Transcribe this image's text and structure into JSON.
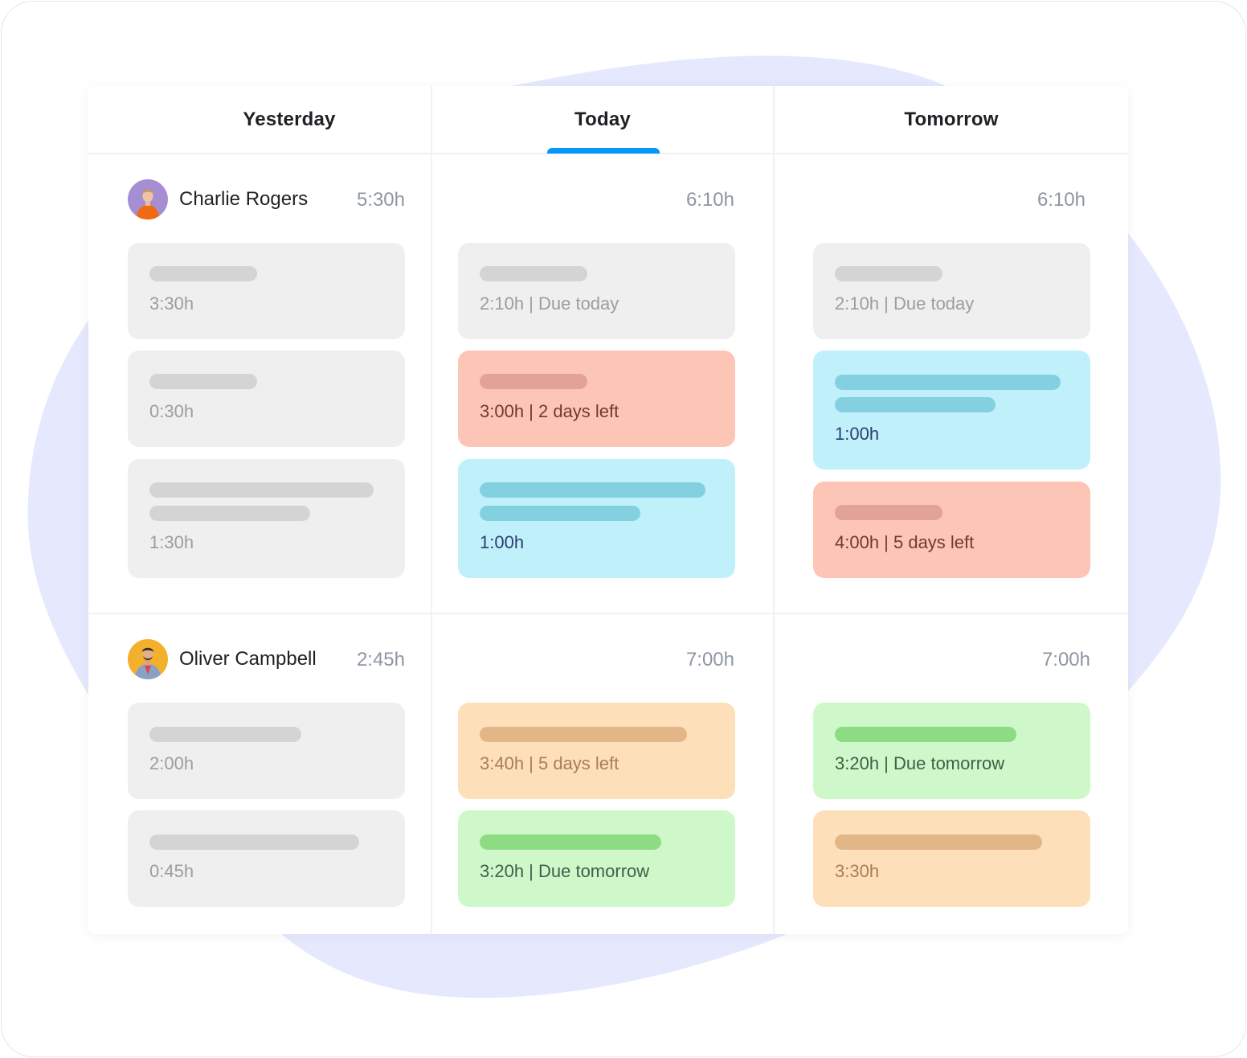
{
  "tabs": [
    {
      "label": "Yesterday",
      "active": false
    },
    {
      "label": "Today",
      "active": true
    },
    {
      "label": "Tomorrow",
      "active": false
    }
  ],
  "colors": {
    "accent": "#0596f7",
    "blob": "#e6e9fd",
    "grey_card": "#efefef",
    "red_card": "#fdc5b6",
    "blue_card": "#c0f1fb",
    "orange_card": "#fddfb9",
    "green_card": "#cef8c9"
  },
  "people": [
    {
      "name": "Charlie Rogers",
      "avatar": "avatar-purple-orange-sweater",
      "totals": [
        "5:30h",
        "6:10h",
        "6:10h"
      ],
      "days": [
        [
          {
            "color": "grey",
            "label": "3:30h"
          },
          {
            "color": "grey",
            "label": "0:30h"
          },
          {
            "color": "grey",
            "label": "1:30h"
          }
        ],
        [
          {
            "color": "grey",
            "label": "2:10h | Due today"
          },
          {
            "color": "red",
            "label": "3:00h | 2 days left"
          },
          {
            "color": "blue",
            "label": "1:00h"
          }
        ],
        [
          {
            "color": "grey",
            "label": "2:10h | Due today"
          },
          {
            "color": "blue",
            "label": "1:00h"
          },
          {
            "color": "red",
            "label": "4:00h | 5 days left"
          }
        ]
      ]
    },
    {
      "name": "Oliver Campbell",
      "avatar": "avatar-yellow-denim-jacket",
      "totals": [
        "2:45h",
        "7:00h",
        "7:00h"
      ],
      "days": [
        [
          {
            "color": "grey",
            "label": "2:00h"
          },
          {
            "color": "grey",
            "label": "0:45h"
          }
        ],
        [
          {
            "color": "orange",
            "label": "3:40h | 5 days left"
          },
          {
            "color": "green",
            "label": "3:20h | Due tomorrow"
          }
        ],
        [
          {
            "color": "green",
            "label": "3:20h | Due tomorrow"
          },
          {
            "color": "orange",
            "label": "3:30h"
          }
        ]
      ]
    }
  ]
}
